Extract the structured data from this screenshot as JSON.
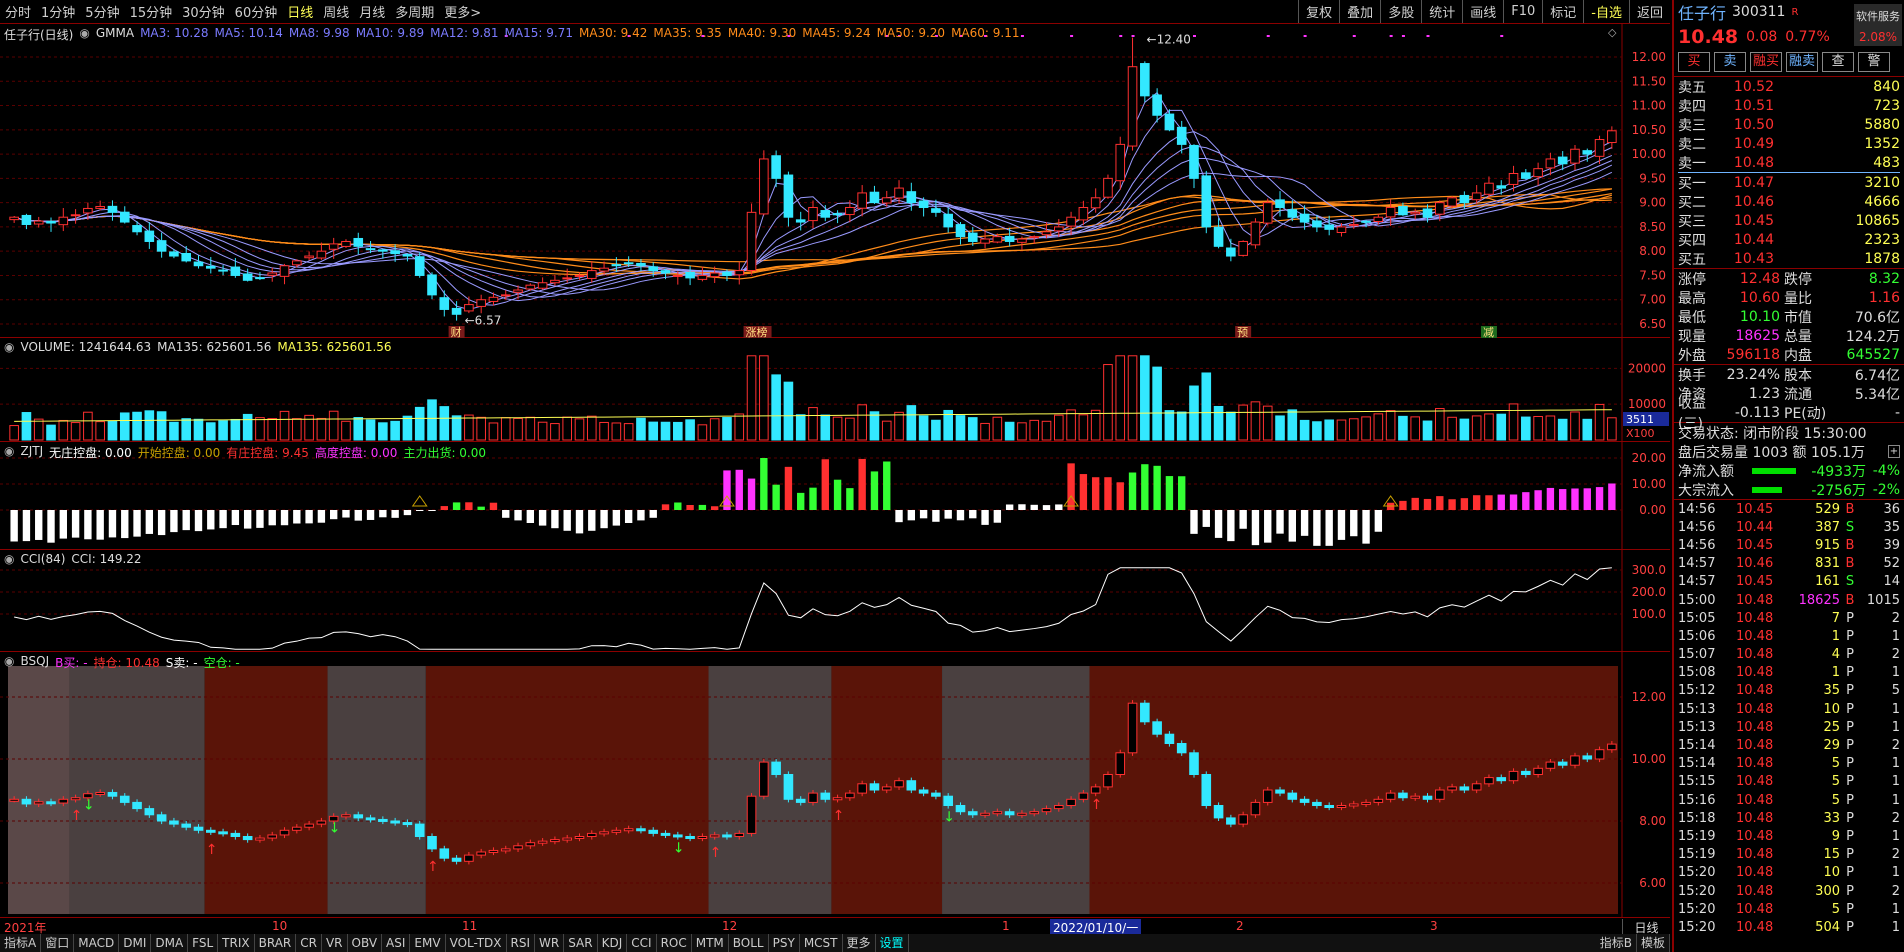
{
  "toolbar": {
    "left": [
      "分时",
      "1分钟",
      "5分钟",
      "15分钟",
      "30分钟",
      "60分钟",
      "日线",
      "周线",
      "月线",
      "多周期",
      "更多>"
    ],
    "active": "日线",
    "right": [
      "复权",
      "叠加",
      "多股",
      "统计",
      "画线",
      "F10",
      "标记",
      "-自选",
      "返回"
    ]
  },
  "main": {
    "title": "任子行(日线)",
    "indicator": "GMMA",
    "ma_labels": [
      {
        "t": "MA3: 10.28",
        "c": "#7b7bff"
      },
      {
        "t": "MA5: 10.14",
        "c": "#7b7bff"
      },
      {
        "t": "MA8: 9.98",
        "c": "#7b7bff"
      },
      {
        "t": "MA10: 9.89",
        "c": "#7b7bff"
      },
      {
        "t": "MA12: 9.81",
        "c": "#7b7bff"
      },
      {
        "t": "MA15: 9.71",
        "c": "#7b7bff"
      },
      {
        "t": "MA30: 9.42",
        "c": "#ff8c1a"
      },
      {
        "t": "MA35: 9.35",
        "c": "#ff8c1a"
      },
      {
        "t": "MA40: 9.30",
        "c": "#ff8c1a"
      },
      {
        "t": "MA45: 9.24",
        "c": "#ff8c1a"
      },
      {
        "t": "MA50: 9.20",
        "c": "#ff8c1a"
      },
      {
        "t": "MA60: 9.11",
        "c": "#ff8c1a"
      }
    ],
    "y_ticks": [
      "12.00",
      "11.50",
      "11.00",
      "10.50",
      "10.00",
      "9.50",
      "9.00",
      "8.50",
      "8.00",
      "7.50",
      "7.00",
      "6.50"
    ],
    "high_label": "12.40",
    "low_label": "6.57",
    "event_tags": [
      "财",
      "涨榜",
      "预",
      "减"
    ]
  },
  "volume": {
    "legend": "VOLUME: 1241644.63",
    "ma_a": "MA135: 625601.56",
    "ma_b": "MA135: 625601.56",
    "y_ticks": [
      "20000",
      "10000"
    ],
    "badge": "3511",
    "unit": "X100"
  },
  "zjtj": {
    "name": "ZJTJ",
    "items": [
      {
        "t": "无庄控盘: 0.00",
        "c": "#ffffff"
      },
      {
        "t": "开始控盘: 0.00",
        "c": "#c8a000"
      },
      {
        "t": "有庄控盘: 9.45",
        "c": "#ff3030"
      },
      {
        "t": "高度控盘: 0.00",
        "c": "#ff33ff"
      },
      {
        "t": "主力出货: 0.00",
        "c": "#33ff33"
      }
    ],
    "y_ticks": [
      "20.00",
      "10.00",
      "0.00"
    ]
  },
  "cci": {
    "name": "CCI(84)",
    "value": "CCI: 149.22",
    "y_ticks": [
      "300.0",
      "200.0",
      "100.0"
    ]
  },
  "bsqj": {
    "name": "BSQJ",
    "items": [
      {
        "t": "B买: -",
        "c": "#ff33ff"
      },
      {
        "t": "持仓: 10.48",
        "c": "#ff3030"
      },
      {
        "t": "S卖: -",
        "c": "#ffffff"
      },
      {
        "t": "空仓: -",
        "c": "#33ff33"
      }
    ],
    "y_ticks": [
      "12.00",
      "10.00",
      "8.00",
      "6.00"
    ]
  },
  "date_axis": {
    "labels": [
      "2021年",
      "10",
      "11",
      "12",
      "1",
      "2022/01/10/一",
      "2",
      "3"
    ],
    "right": "日线"
  },
  "tabs": {
    "left": [
      "指标A",
      "窗口",
      "MACD",
      "DMI",
      "DMA",
      "FSL",
      "TRIX",
      "BRAR",
      "CR",
      "VR",
      "OBV",
      "ASI",
      "EMV",
      "VOL-TDX",
      "RSI",
      "WR",
      "SAR",
      "KDJ",
      "CCI",
      "ROC",
      "MTM",
      "BOLL",
      "PSY",
      "MCST",
      "更多",
      "设置"
    ],
    "selected": "设置",
    "right": [
      "指标B",
      "模板"
    ]
  },
  "panel": {
    "name": "任子行",
    "code": "300311",
    "r": "R",
    "soft_label": "软件服务",
    "soft_pct": "2.08%",
    "price": "10.48",
    "change": "0.08",
    "change_pct": "0.77%",
    "buttons": [
      {
        "t": "买",
        "c": "#ff3030"
      },
      {
        "t": "卖",
        "c": "#6fb4ff"
      },
      {
        "t": "融买",
        "c": "#ff3030"
      },
      {
        "t": "融卖",
        "c": "#6fb4ff"
      },
      {
        "t": "查",
        "c": "#ddd"
      },
      {
        "t": "警",
        "c": "#ddd"
      }
    ],
    "asks": [
      {
        "l": "卖五",
        "p": "10.52",
        "v": "840"
      },
      {
        "l": "卖四",
        "p": "10.51",
        "v": "723"
      },
      {
        "l": "卖三",
        "p": "10.50",
        "v": "5880"
      },
      {
        "l": "卖二",
        "p": "10.49",
        "v": "1352"
      },
      {
        "l": "卖一",
        "p": "10.48",
        "v": "483"
      }
    ],
    "bids": [
      {
        "l": "买一",
        "p": "10.47",
        "v": "3210"
      },
      {
        "l": "买二",
        "p": "10.46",
        "v": "4666"
      },
      {
        "l": "买三",
        "p": "10.45",
        "v": "10865"
      },
      {
        "l": "买四",
        "p": "10.44",
        "v": "2323"
      },
      {
        "l": "买五",
        "p": "10.43",
        "v": "1878"
      }
    ],
    "stats1": [
      {
        "k": "涨停",
        "v": "12.48",
        "vc": "#ff3030",
        "k2": "跌停",
        "v2": "8.32",
        "v2c": "#33ff33"
      },
      {
        "k": "最高",
        "v": "10.60",
        "vc": "#ff3030",
        "k2": "量比",
        "v2": "1.16",
        "v2c": "#ff3030"
      },
      {
        "k": "最低",
        "v": "10.10",
        "vc": "#33ff33",
        "k2": "市值",
        "v2": "70.6亿",
        "v2c": "#ddd"
      },
      {
        "k": "现量",
        "v": "18625",
        "vc": "#ff33ff",
        "k2": "总量",
        "v2": "124.2万",
        "v2c": "#ddd"
      },
      {
        "k": "外盘",
        "v": "596118",
        "vc": "#ff3030",
        "k2": "内盘",
        "v2": "645527",
        "v2c": "#33ff33"
      }
    ],
    "stats2": [
      {
        "k": "换手",
        "v": "23.24%",
        "vc": "#ddd",
        "k2": "股本",
        "v2": "6.74亿",
        "v2c": "#ddd"
      },
      {
        "k": "净资",
        "v": "1.23",
        "vc": "#ddd",
        "k2": "流通",
        "v2": "5.34亿",
        "v2c": "#ddd"
      },
      {
        "k": "收益(三)",
        "v": "-0.113",
        "vc": "#ddd",
        "k2": "PE(动)",
        "v2": "-",
        "v2c": "#ddd"
      }
    ],
    "trade_status": "交易状态: 闭市阶段 15:30:00",
    "after_trade": "盘后交易量 1003 额 105.1万",
    "flows": [
      {
        "k": "净流入额",
        "v": "-4933万",
        "p": "-4%"
      },
      {
        "k": "大宗流入",
        "v": "-2756万",
        "p": "-2%"
      }
    ],
    "ticks": [
      {
        "t": "14:56",
        "p": "10.45",
        "v": "529",
        "d": "B",
        "n": "36"
      },
      {
        "t": "14:56",
        "p": "10.44",
        "v": "387",
        "d": "S",
        "n": "35"
      },
      {
        "t": "14:56",
        "p": "10.45",
        "v": "915",
        "d": "B",
        "n": "39"
      },
      {
        "t": "14:57",
        "p": "10.46",
        "v": "831",
        "d": "B",
        "n": "52"
      },
      {
        "t": "14:57",
        "p": "10.45",
        "v": "161",
        "d": "S",
        "n": "14"
      },
      {
        "t": "15:00",
        "p": "10.48",
        "v": "18625",
        "d": "B",
        "n": "1015"
      },
      {
        "t": "15:05",
        "p": "10.48",
        "v": "7",
        "d": "P",
        "n": "2"
      },
      {
        "t": "15:06",
        "p": "10.48",
        "v": "1",
        "d": "P",
        "n": "1"
      },
      {
        "t": "15:07",
        "p": "10.48",
        "v": "4",
        "d": "P",
        "n": "2"
      },
      {
        "t": "15:08",
        "p": "10.48",
        "v": "1",
        "d": "P",
        "n": "1"
      },
      {
        "t": "15:12",
        "p": "10.48",
        "v": "35",
        "d": "P",
        "n": "5"
      },
      {
        "t": "15:13",
        "p": "10.48",
        "v": "10",
        "d": "P",
        "n": "1"
      },
      {
        "t": "15:13",
        "p": "10.48",
        "v": "25",
        "d": "P",
        "n": "1"
      },
      {
        "t": "15:14",
        "p": "10.48",
        "v": "29",
        "d": "P",
        "n": "2"
      },
      {
        "t": "15:14",
        "p": "10.48",
        "v": "5",
        "d": "P",
        "n": "1"
      },
      {
        "t": "15:15",
        "p": "10.48",
        "v": "5",
        "d": "P",
        "n": "1"
      },
      {
        "t": "15:16",
        "p": "10.48",
        "v": "5",
        "d": "P",
        "n": "1"
      },
      {
        "t": "15:18",
        "p": "10.48",
        "v": "33",
        "d": "P",
        "n": "2"
      },
      {
        "t": "15:19",
        "p": "10.48",
        "v": "9",
        "d": "P",
        "n": "1"
      },
      {
        "t": "15:19",
        "p": "10.48",
        "v": "15",
        "d": "P",
        "n": "2"
      },
      {
        "t": "15:20",
        "p": "10.48",
        "v": "10",
        "d": "P",
        "n": "1"
      },
      {
        "t": "15:20",
        "p": "10.48",
        "v": "300",
        "d": "P",
        "n": "2"
      },
      {
        "t": "15:20",
        "p": "10.48",
        "v": "5",
        "d": "P",
        "n": "1"
      },
      {
        "t": "15:20",
        "p": "10.48",
        "v": "504",
        "d": "P",
        "n": "1"
      }
    ]
  },
  "chart_data": {
    "type": "candlestick",
    "closes": [
      8.7,
      8.55,
      8.62,
      8.58,
      8.7,
      8.75,
      8.88,
      8.92,
      8.8,
      8.6,
      8.4,
      8.2,
      8.0,
      7.9,
      7.8,
      7.7,
      7.65,
      7.6,
      7.5,
      7.4,
      7.45,
      7.55,
      7.7,
      7.8,
      7.9,
      8.0,
      8.15,
      8.2,
      8.1,
      8.05,
      8.0,
      7.95,
      7.9,
      7.5,
      7.1,
      6.8,
      6.7,
      6.9,
      7.0,
      7.05,
      7.1,
      7.2,
      7.3,
      7.35,
      7.4,
      7.45,
      7.5,
      7.6,
      7.65,
      7.7,
      7.75,
      7.7,
      7.6,
      7.55,
      7.5,
      7.45,
      7.5,
      7.55,
      7.5,
      7.6,
      8.8,
      9.9,
      9.5,
      8.7,
      8.6,
      8.9,
      8.7,
      8.75,
      8.9,
      9.2,
      9.0,
      9.1,
      9.3,
      9.0,
      8.9,
      8.8,
      8.5,
      8.3,
      8.2,
      8.25,
      8.3,
      8.2,
      8.25,
      8.3,
      8.4,
      8.5,
      8.7,
      8.9,
      9.1,
      9.5,
      10.2,
      11.8,
      11.2,
      10.8,
      10.5,
      10.2,
      9.5,
      8.5,
      8.1,
      7.9,
      8.2,
      8.6,
      9.0,
      8.9,
      8.7,
      8.6,
      8.5,
      8.45,
      8.5,
      8.55,
      8.6,
      8.7,
      8.9,
      8.75,
      8.8,
      8.7,
      9.0,
      9.1,
      9.0,
      9.2,
      9.4,
      9.3,
      9.6,
      9.5,
      9.7,
      9.9,
      9.8,
      10.1,
      10.0,
      10.3,
      10.48
    ],
    "y_range": [
      6.5,
      12.0
    ]
  }
}
